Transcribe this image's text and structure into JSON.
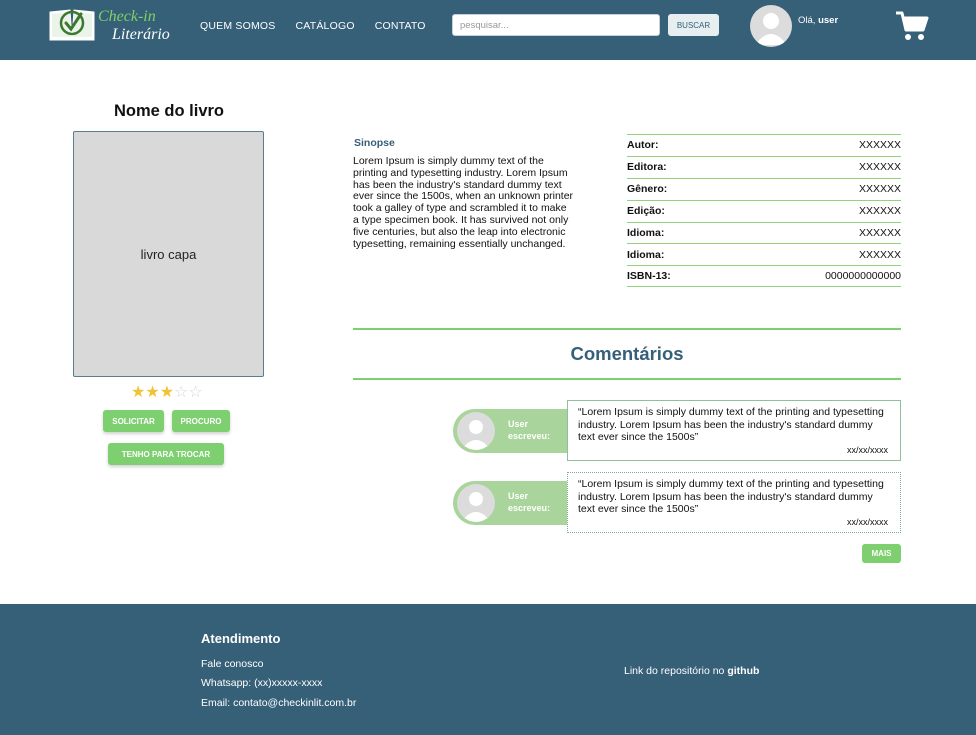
{
  "header": {
    "logo_line1": "Check-in",
    "logo_line2": "Literário",
    "nav": [
      "QUEM SOMOS",
      "CATÁLOGO",
      "CONTATO"
    ],
    "search_placeholder": "pesquisar...",
    "search_button": "BUSCAR",
    "greeting_prefix": "Olá,",
    "greeting_user": "user",
    "cart_icon": "shopping-cart-icon"
  },
  "book": {
    "title": "Nome do livro",
    "cover_label": "livro capa",
    "rating": 3,
    "rating_max": 5,
    "buttons": {
      "solicitar": "SOLICITAR",
      "procuro": "PROCURO",
      "tenho": "TENHO PARA TROCAR"
    }
  },
  "sinopse": {
    "label": "Sinopse",
    "text": "Lorem Ipsum is simply dummy text of the printing and typesetting industry. Lorem Ipsum has been the industry's standard dummy text ever since the 1500s, when an unknown printer took a galley of type and scrambled it to make a type specimen book. It has survived not only five centuries, but also the leap into electronic typesetting, remaining essentially unchanged."
  },
  "details": [
    {
      "label": "Autor:",
      "value": "XXXXXX"
    },
    {
      "label": "Editora:",
      "value": "XXXXXX"
    },
    {
      "label": "Gênero:",
      "value": "XXXXXX"
    },
    {
      "label": "Edição:",
      "value": "XXXXXX"
    },
    {
      "label": "Idioma:",
      "value": "XXXXXX"
    },
    {
      "label": "Idioma:",
      "value": "XXXXXX"
    },
    {
      "label": "ISBN-13:",
      "value": "0000000000000"
    }
  ],
  "comments_section": {
    "title": "Comentários",
    "more_button": "MAIS",
    "items": [
      {
        "user_label": "User escreveu:",
        "text": "“Lorem Ipsum is simply dummy text of the printing and typesetting industry. Lorem Ipsum has been the industry's standard dummy text ever since the 1500s”",
        "date": "xx/xx/xxxx"
      },
      {
        "user_label": "User escreveu:",
        "text": "“Lorem Ipsum is simply dummy text of the printing and typesetting industry. Lorem Ipsum has been the industry's standard dummy text ever since the 1500s”",
        "date": "xx/xx/xxxx"
      }
    ]
  },
  "footer": {
    "title": "Atendimento",
    "items": [
      "Fale conosco",
      "Whatsapp: (xx)xxxxx-xxxx",
      "Email: contato@checkinlit.com.br"
    ],
    "repo_prefix": "Link do repositório no",
    "repo_link": "github"
  },
  "colors": {
    "header_bg": "#365f78",
    "accent_green": "#7dcf6f",
    "star_on": "#f1c232",
    "star_off": "#d6d6d6"
  }
}
